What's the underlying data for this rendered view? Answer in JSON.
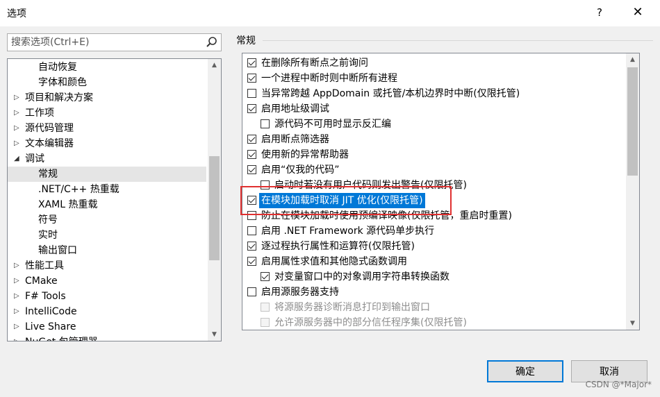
{
  "window": {
    "title": "选项",
    "help_label": "?",
    "close_label": "✕"
  },
  "search": {
    "placeholder": "搜索选项(Ctrl+E)",
    "value": ""
  },
  "tree": {
    "items": [
      {
        "label": "自动恢复",
        "level": 1,
        "arrow": ""
      },
      {
        "label": "字体和颜色",
        "level": 1,
        "arrow": ""
      },
      {
        "label": "项目和解决方案",
        "level": 0,
        "arrow": "▷"
      },
      {
        "label": "工作项",
        "level": 0,
        "arrow": "▷"
      },
      {
        "label": "源代码管理",
        "level": 0,
        "arrow": "▷"
      },
      {
        "label": "文本编辑器",
        "level": 0,
        "arrow": "▷"
      },
      {
        "label": "调试",
        "level": 0,
        "arrow": "◢"
      },
      {
        "label": "常规",
        "level": 1,
        "arrow": "",
        "selected": true
      },
      {
        "label": ".NET/C++ 热重载",
        "level": 1,
        "arrow": ""
      },
      {
        "label": "XAML 热重载",
        "level": 1,
        "arrow": ""
      },
      {
        "label": "符号",
        "level": 1,
        "arrow": ""
      },
      {
        "label": "实时",
        "level": 1,
        "arrow": ""
      },
      {
        "label": "输出窗口",
        "level": 1,
        "arrow": ""
      },
      {
        "label": "性能工具",
        "level": 0,
        "arrow": "▷"
      },
      {
        "label": "CMake",
        "level": 0,
        "arrow": "▷"
      },
      {
        "label": "F# Tools",
        "level": 0,
        "arrow": "▷"
      },
      {
        "label": "IntelliCode",
        "level": 0,
        "arrow": "▷"
      },
      {
        "label": "Live Share",
        "level": 0,
        "arrow": "▷"
      },
      {
        "label": "NuGet 包管理器",
        "level": 0,
        "arrow": "▷"
      }
    ]
  },
  "section": {
    "title": "常规"
  },
  "options": [
    {
      "label": "在删除所有断点之前询问",
      "checked": true,
      "indent": 0
    },
    {
      "label": "一个进程中断时则中断所有进程",
      "checked": true,
      "indent": 0
    },
    {
      "label": "当异常跨越 AppDomain 或托管/本机边界时中断(仅限托管)",
      "checked": false,
      "indent": 0
    },
    {
      "label": "启用地址级调试",
      "checked": true,
      "indent": 0
    },
    {
      "label": "源代码不可用时显示反汇编",
      "checked": false,
      "indent": 1
    },
    {
      "label": "启用断点筛选器",
      "checked": true,
      "indent": 0
    },
    {
      "label": "使用新的异常帮助器",
      "checked": true,
      "indent": 0
    },
    {
      "label": "启用“仅我的代码”",
      "checked": true,
      "indent": 0
    },
    {
      "label": "启动时若没有用户代码则发出警告(仅限托管)",
      "checked": false,
      "indent": 1
    },
    {
      "label": "在模块加载时取消 JIT 优化(仅限托管)",
      "checked": true,
      "indent": 0,
      "highlight": true
    },
    {
      "label": "防止在模块加载时使用预编译映像(仅限托管，重启时重置)",
      "checked": false,
      "indent": 0
    },
    {
      "label": "启用 .NET Framework 源代码单步执行",
      "checked": false,
      "indent": 0
    },
    {
      "label": "逐过程执行属性和运算符(仅限托管)",
      "checked": true,
      "indent": 0
    },
    {
      "label": "启用属性求值和其他隐式函数调用",
      "checked": true,
      "indent": 0
    },
    {
      "label": "对变量窗口中的对象调用字符串转换函数",
      "checked": true,
      "indent": 1
    },
    {
      "label": "启用源服务器支持",
      "checked": false,
      "indent": 0
    },
    {
      "label": "将源服务器诊断消息打印到输出窗口",
      "checked": false,
      "indent": 1,
      "disabled": true
    },
    {
      "label": "允许源服务器中的部分信任程序集(仅限托管)",
      "checked": false,
      "indent": 1,
      "disabled": true
    }
  ],
  "buttons": {
    "ok": "确定",
    "cancel": "取消"
  },
  "watermark": "CSDN @*Major*",
  "icons": {
    "search": "search-icon",
    "scroll_up": "▲",
    "scroll_down": "▼"
  },
  "colors": {
    "selection": "#0078d7",
    "annotation_box": "#e03030"
  }
}
